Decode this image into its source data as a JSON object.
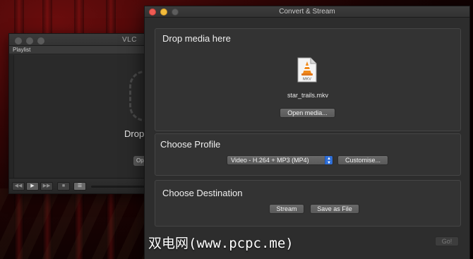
{
  "vlc_window": {
    "title": "VLC",
    "playlist_header": "Playlist",
    "drop_text": "Drop",
    "open_button_label": "Op",
    "controls": {
      "rewind": "◀◀",
      "play": "▶",
      "forward": "▶▶",
      "stop": "■",
      "playlist": "☰"
    }
  },
  "convert_window": {
    "title": "Convert & Stream",
    "drop_section": {
      "title": "Drop media here",
      "file_type_badge": "MKV",
      "file_name": "star_trails.mkv",
      "open_button_label": "Open media..."
    },
    "profile_section": {
      "title": "Choose Profile",
      "selected_profile": "Video - H.264 + MP3 (MP4)",
      "customise_label": "Customise..."
    },
    "destination_section": {
      "title": "Choose Destination",
      "stream_label": "Stream",
      "save_as_file_label": "Save as File"
    },
    "go_label": "Go!"
  },
  "watermark": "双电网(www.pcpc.me)",
  "colors": {
    "close": "#ee5b53",
    "minimize": "#f3bb3b",
    "select_arrow": "#2f6fd8",
    "vlc_cone": "#f08a1c"
  },
  "icons": {
    "file_icon": "vlc-mkv-file-icon",
    "select_icon": "up-down-chevron-icon"
  }
}
